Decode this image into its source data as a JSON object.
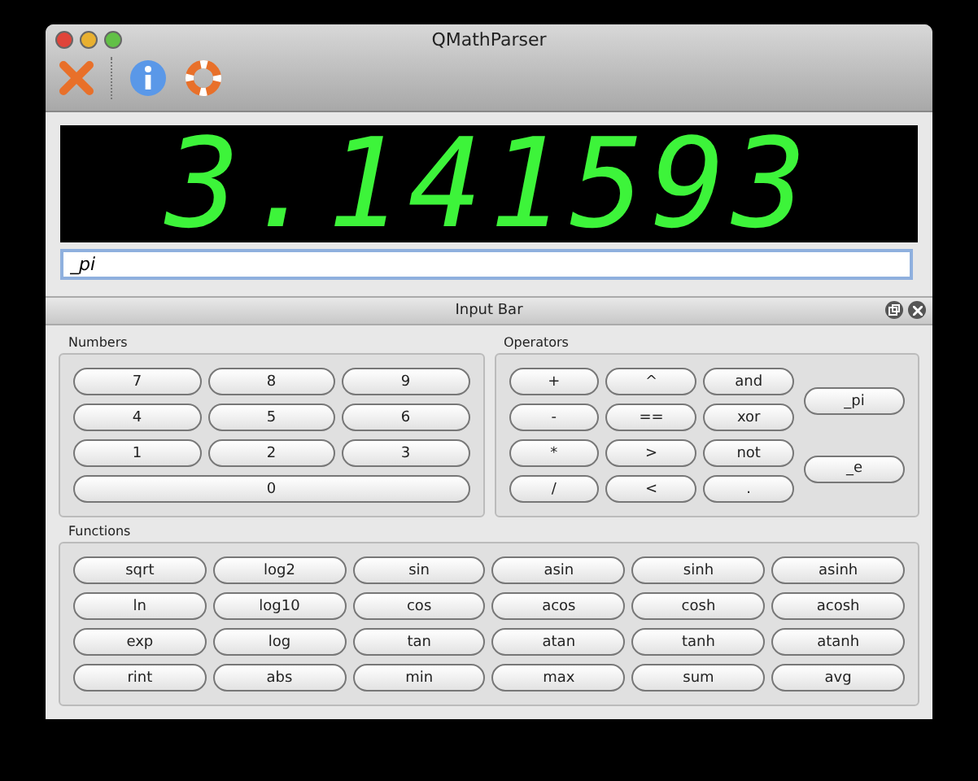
{
  "window": {
    "title": "QMathParser"
  },
  "toolbar": [
    {
      "kind": "quit"
    },
    {
      "kind": "about"
    },
    {
      "kind": "help"
    }
  ],
  "display": {
    "value": "3.141593"
  },
  "input": {
    "value": "_pi"
  },
  "dock": {
    "title": "Input Bar"
  },
  "numbers": {
    "title": "Numbers",
    "rows": [
      [
        "7",
        "8",
        "9"
      ],
      [
        "4",
        "5",
        "6"
      ],
      [
        "1",
        "2",
        "3"
      ]
    ],
    "wide_key": "0"
  },
  "operators": {
    "title": "Operators",
    "rows": [
      [
        "+",
        "^",
        "and"
      ],
      [
        "-",
        "==",
        "xor"
      ],
      [
        "*",
        ">",
        "not"
      ],
      [
        "/",
        "<",
        "."
      ]
    ],
    "constants": [
      "_pi",
      "_e"
    ]
  },
  "functions": {
    "title": "Functions",
    "rows": [
      [
        "sqrt",
        "log2",
        "sin",
        "asin",
        "sinh",
        "asinh"
      ],
      [
        "ln",
        "log10",
        "cos",
        "acos",
        "cosh",
        "acosh"
      ],
      [
        "exp",
        "log",
        "tan",
        "atan",
        "tanh",
        "atanh"
      ],
      [
        "rint",
        "abs",
        "min",
        "max",
        "sum",
        "avg"
      ]
    ]
  }
}
